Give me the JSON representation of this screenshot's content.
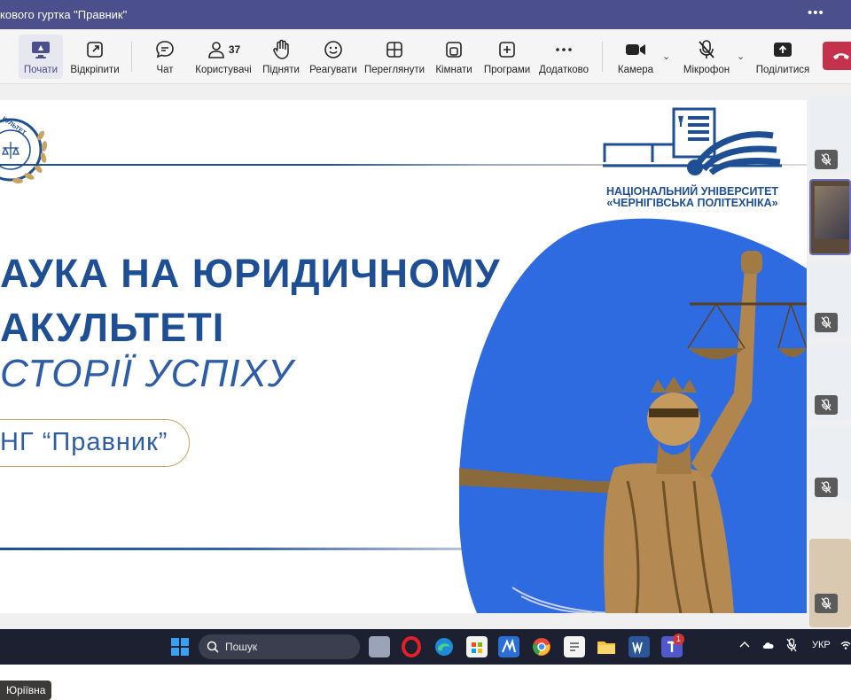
{
  "window": {
    "title": "кового гуртка \"Правник\"",
    "more_label": "•••"
  },
  "toolbar": {
    "items": [
      {
        "label": "Почати",
        "icon": "share-screen-icon",
        "active": true
      },
      {
        "label": "Відкріпити",
        "icon": "pop-out-icon"
      },
      {
        "label": "Чат",
        "icon": "chat-icon"
      },
      {
        "label": "Користувачі",
        "icon": "people-icon",
        "count": "37"
      },
      {
        "label": "Підняти",
        "icon": "raise-hand-icon"
      },
      {
        "label": "Реагувати",
        "icon": "emoji-icon"
      },
      {
        "label": "Переглянути",
        "icon": "view-layout-icon"
      },
      {
        "label": "Кімнати",
        "icon": "rooms-icon"
      },
      {
        "label": "Програми",
        "icon": "apps-icon"
      },
      {
        "label": "Додатково",
        "icon": "more-icon"
      },
      {
        "label": "Камера",
        "icon": "camera-icon"
      },
      {
        "label": "Мікрофон",
        "icon": "mic-off-icon"
      },
      {
        "label": "Поділитися",
        "icon": "share-icon"
      }
    ],
    "hangup_icon": "hangup-icon"
  },
  "slide": {
    "heading_line1": "АУКА НА ЮРИДИЧНОМУ",
    "heading_line2": "АКУЛЬТЕТІ",
    "subheading": "СТОРІЇ УСПІХУ",
    "pill_text": "НГ “Правник”",
    "logo_left_text": "КУЛЬТЕТ",
    "university_line1": "НАЦІОНАЛЬНИЙ УНІВЕРСИТЕТ",
    "university_line2": "«ЧЕРНІГІВСЬКА ПОЛІТЕХНІКА»",
    "colors": {
      "primary": "#1e4e94",
      "accent": "#2f6be0",
      "gold": "#c9a45e"
    }
  },
  "presenter_name": "Юріївна",
  "participants": [
    {
      "muted": true
    },
    {
      "muted": false,
      "selected": true
    },
    {
      "muted": true
    },
    {
      "muted": true
    },
    {
      "muted": true
    },
    {
      "muted": true
    }
  ],
  "taskbar": {
    "search_placeholder": "Пошук",
    "language": "УКР",
    "teams_badge": "1",
    "apps": [
      "task-view-icon",
      "opera-icon",
      "edge-icon",
      "store-icon",
      "mail-icon",
      "chrome-icon",
      "notes-icon",
      "explorer-icon",
      "word-icon",
      "teams-icon"
    ]
  }
}
